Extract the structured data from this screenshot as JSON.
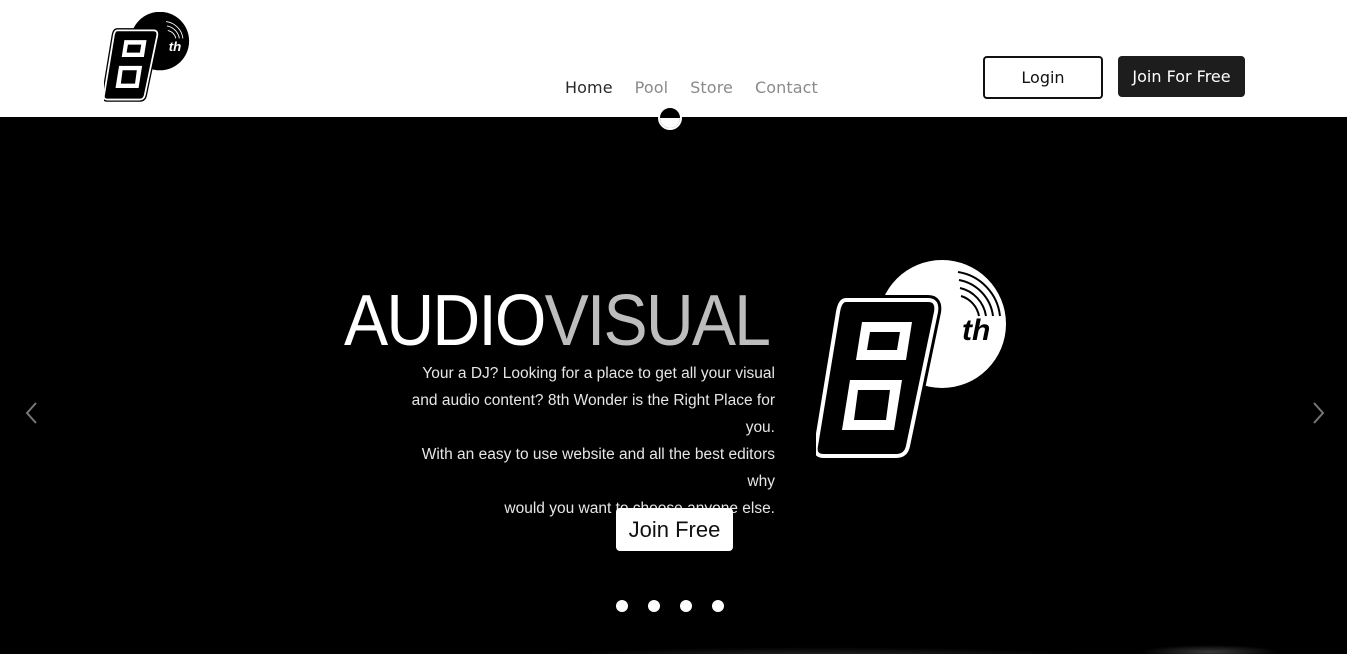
{
  "header": {
    "logo_icon": "8th-logo-icon",
    "nav": [
      {
        "label": "Home",
        "active": true
      },
      {
        "label": "Pool",
        "active": false
      },
      {
        "label": "Store",
        "active": false
      },
      {
        "label": "Contact",
        "active": false
      }
    ],
    "login_label": "Login",
    "join_label": "Join For Free"
  },
  "hero": {
    "headline_part1": "AUDIO",
    "headline_part2": "VISUAL",
    "blurb_lines": [
      "Your a DJ? Looking for a place to get all your visual",
      "and audio content? 8th Wonder is the Right Place for you.",
      "With an easy to use website and all the best editors why",
      "would you want to choose anyone else."
    ],
    "cta_label": "Join Free",
    "logo_icon": "8th-logo-icon",
    "prev_icon": "chevron-left-icon",
    "next_icon": "chevron-right-icon",
    "slide_count": 4
  },
  "colors": {
    "background": "#000000",
    "header_bg": "#ffffff",
    "accent_dark": "#1d1d1d",
    "nav_inactive": "#8a8a8a",
    "headline_grey": "#bdbdbd"
  }
}
